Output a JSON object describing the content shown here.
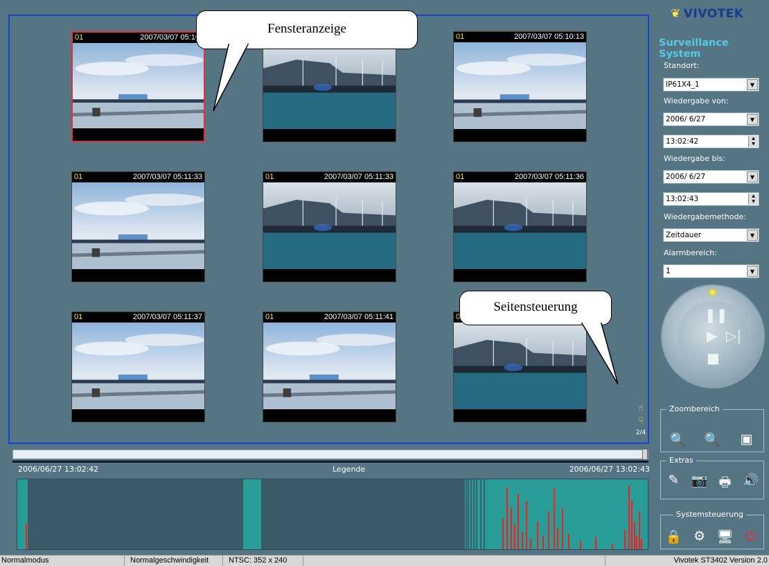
{
  "callouts": {
    "window": "Fensteranzeige",
    "page": "Seitensteuerung"
  },
  "grid": [
    {
      "channel": "01",
      "timestamp": "2007/03/07 05:10:",
      "scene": "harbor",
      "selected": true
    },
    {
      "channel": "",
      "timestamp": "",
      "scene": "pier",
      "selected": false
    },
    {
      "channel": "01",
      "timestamp": "2007/03/07 05:10:13",
      "scene": "harbor",
      "selected": false
    },
    {
      "channel": "01",
      "timestamp": "2007/03/07 05:11:33",
      "scene": "harbor",
      "selected": false
    },
    {
      "channel": "01",
      "timestamp": "2007/03/07 05:11:33",
      "scene": "pier",
      "selected": false
    },
    {
      "channel": "01",
      "timestamp": "2007/03/07 05:11:36",
      "scene": "pier",
      "selected": false
    },
    {
      "channel": "01",
      "timestamp": "2007/03/07 05:11:37",
      "scene": "harbor",
      "selected": false
    },
    {
      "channel": "01",
      "timestamp": "2007/03/07 05:11:41",
      "scene": "harbor",
      "selected": false
    },
    {
      "channel": "0",
      "timestamp": "",
      "scene": "pier",
      "selected": false
    }
  ],
  "page_control": {
    "page": "2/4",
    "up_icon": "hand-up-icon",
    "down_icon": "hand-down-icon"
  },
  "timeline": {
    "start": "2006/06/27 13:02:42",
    "end": "2006/06/27 13:02:43",
    "legend": "Legende",
    "slider_position": 1.0,
    "colors": {
      "bg": "#2a9c97",
      "block": "#3a5a68",
      "alarm": "#ff1a1a",
      "dark": "#3a6070"
    }
  },
  "sidebar": {
    "brand": "VIVOTEK",
    "subtitle": "Surveillance System",
    "location_label": "Standort:",
    "location_value": "IP61X4_1",
    "from_label": "Wiedergabe von:",
    "from_date": "2006/ 6/27",
    "from_time": "13:02:42",
    "to_label": "Wiedergabe bis:",
    "to_date": "2006/ 6/27",
    "to_time": "13:02:43",
    "method_label": "Wiedergabemethode:",
    "method_value": "Zeitdauer",
    "alarm_label": "Alarmbereich:",
    "alarm_value": "1",
    "zoom_title": "Zoombereich",
    "extras_title": "Extras",
    "system_title": "Systemsteuerung"
  },
  "icons": {
    "dropdown": "▼",
    "spin": "▲▼",
    "pause": "❚❚",
    "play": "▶",
    "next": "▷|",
    "stop": "■",
    "zoom_in": "zoom-in-icon",
    "zoom_out": "zoom-out-icon",
    "color": "color-adjust-icon",
    "edit": "edit-icon",
    "camera": "snapshot-icon",
    "print": "print-icon",
    "audio": "audio-icon",
    "lock": "lock-icon",
    "tools": "settings-icon",
    "monitor": "monitor-icon",
    "power": "power-icon"
  },
  "statusbar": {
    "mode": "Normalmodus",
    "speed": "Normalgeschwindigkeit",
    "format": "NTSC: 352 x 240",
    "version": "Vivotek ST3402  Version 2.0"
  }
}
